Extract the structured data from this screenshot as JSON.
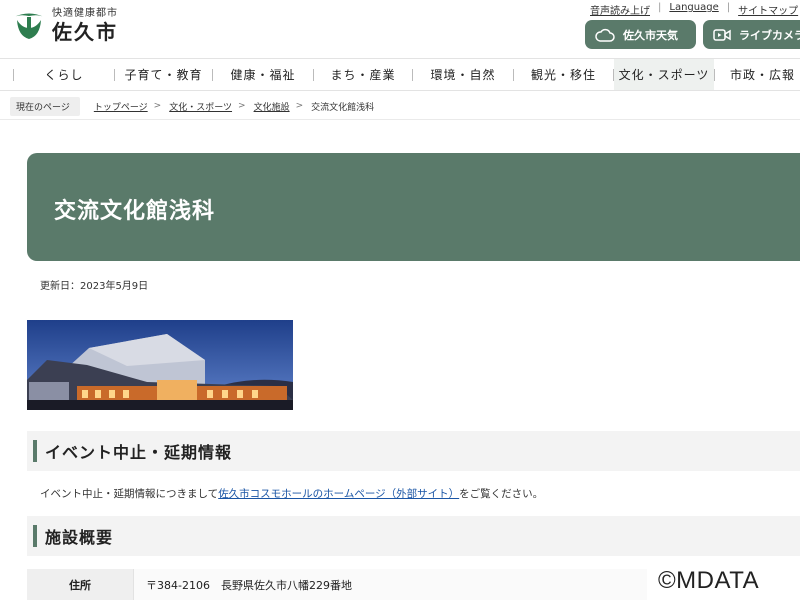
{
  "header": {
    "logo_sub": "快適健康都市",
    "logo_main": "佐久市",
    "util_links": [
      "音声読み上げ",
      "Language",
      "サイトマップ"
    ],
    "weather_label": "佐久市天気",
    "camera_label": "ライブカメラ"
  },
  "nav": {
    "items": [
      "くらし",
      "子育て・教育",
      "健康・福祉",
      "まち・産業",
      "環境・自然",
      "観光・移住",
      "文化・スポーツ",
      "市政・広報"
    ],
    "active": "文化・スポーツ"
  },
  "breadcrumb": {
    "here": "現在のページ",
    "links": [
      "トップページ",
      "文化・スポーツ",
      "文化施設"
    ],
    "current": "交流文化館浅科"
  },
  "page": {
    "title": "交流文化館浅科",
    "updated": "更新日：2023年5月9日"
  },
  "event_section": {
    "heading": "イベント中止・延期情報",
    "text_before": "イベント中止・延期情報につきまして",
    "link": "佐久市コスモホールのホームページ（外部サイト）",
    "text_after": "をご覧ください。"
  },
  "facility_section": {
    "heading": "施設概要",
    "rows": [
      {
        "label": "住所",
        "value": "〒384-2106　長野県佐久市八幡229番地"
      }
    ]
  },
  "watermark": "©MDATA",
  "colors": {
    "accent": "#5a7a6a",
    "link": "#1a55a5"
  }
}
